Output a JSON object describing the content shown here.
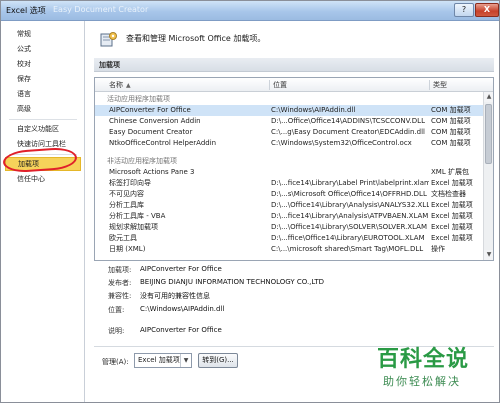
{
  "window": {
    "title": "Excel 选项",
    "ghost_title": "Easy Document Creator",
    "help_label": "?",
    "close_label": "X"
  },
  "nav": {
    "items": [
      {
        "label": "常规"
      },
      {
        "label": "公式"
      },
      {
        "label": "校对"
      },
      {
        "label": "保存"
      },
      {
        "label": "语言"
      },
      {
        "label": "高级"
      },
      {
        "label": "自定义功能区"
      },
      {
        "label": "快速访问工具栏"
      },
      {
        "label": "加载项",
        "selected": true
      },
      {
        "label": "信任中心"
      }
    ]
  },
  "header": {
    "text": "查看和管理 Microsoft Office 加载项。"
  },
  "section": {
    "title": "加载项"
  },
  "table": {
    "columns": [
      "名称",
      "位置",
      "类型"
    ],
    "sort_indicator": "▲",
    "groups": [
      {
        "title": "活动应用程序加载项",
        "rows": [
          {
            "name": "AIPConverter For Office",
            "location": "C:\\Windows\\AIPAddin.dll",
            "type": "COM 加载项",
            "selected": true
          },
          {
            "name": "Chinese Conversion Addin",
            "location": "D:\\...Office\\Office14\\ADDINS\\TCSCCONV.DLL",
            "type": "COM 加载项"
          },
          {
            "name": "Easy Document Creator",
            "location": "C:\\...g\\Easy Document Creator\\EDCAddin.dll",
            "type": "COM 加载项"
          },
          {
            "name": "NtkoOfficeControl HelperAddin",
            "location": "C:\\Windows\\System32\\OfficeControl.ocx",
            "type": "COM 加载项"
          }
        ]
      },
      {
        "title": "非活动应用程序加载项",
        "rows": [
          {
            "name": "Microsoft Actions Pane 3",
            "location": "",
            "type": "XML 扩展包"
          },
          {
            "name": "标签打印向导",
            "location": "D:\\...fice14\\Library\\Label Print\\labelprint.xlam",
            "type": "Excel 加载项"
          },
          {
            "name": "不可见内容",
            "location": "D:\\...s\\Microsoft Office\\Office14\\OFFRHD.DLL",
            "type": "文档检查器"
          },
          {
            "name": "分析工具库",
            "location": "D:\\...\\Office14\\Library\\Analysis\\ANALYS32.XLL",
            "type": "Excel 加载项"
          },
          {
            "name": "分析工具库 - VBA",
            "location": "D:\\...fice14\\Library\\Analysis\\ATPVBAEN.XLAM",
            "type": "Excel 加载项"
          },
          {
            "name": "规划求解加载项",
            "location": "D:\\...\\Office14\\Library\\SOLVER\\SOLVER.XLAM",
            "type": "Excel 加载项"
          },
          {
            "name": "欧元工具",
            "location": "D:\\...ffice\\Office14\\Library\\EUROTOOL.XLAM",
            "type": "Excel 加载项"
          },
          {
            "name": "日期 (XML)",
            "location": "C:\\...\\microsoft shared\\Smart Tag\\MOFL.DLL",
            "type": "操作"
          }
        ]
      }
    ]
  },
  "details": {
    "addin": {
      "label": "加载项:",
      "value": "AIPConverter For Office"
    },
    "publisher": {
      "label": "发布者:",
      "value": "BEIJING DIANJU INFORMATION TECHNOLOGY CO.,LTD"
    },
    "compat": {
      "label": "兼容性:",
      "value": "没有可用的兼容性信息"
    },
    "location": {
      "label": "位置:",
      "value": "C:\\Windows\\AIPAddin.dll"
    },
    "description": {
      "label": "说明:",
      "value": "AIPConverter For Office"
    }
  },
  "manage": {
    "label": "管理(A):",
    "selected": "Excel 加载项",
    "go_label": "转到(G)..."
  },
  "watermark": {
    "brand": "百科全说",
    "sub": "助你轻松解决"
  }
}
